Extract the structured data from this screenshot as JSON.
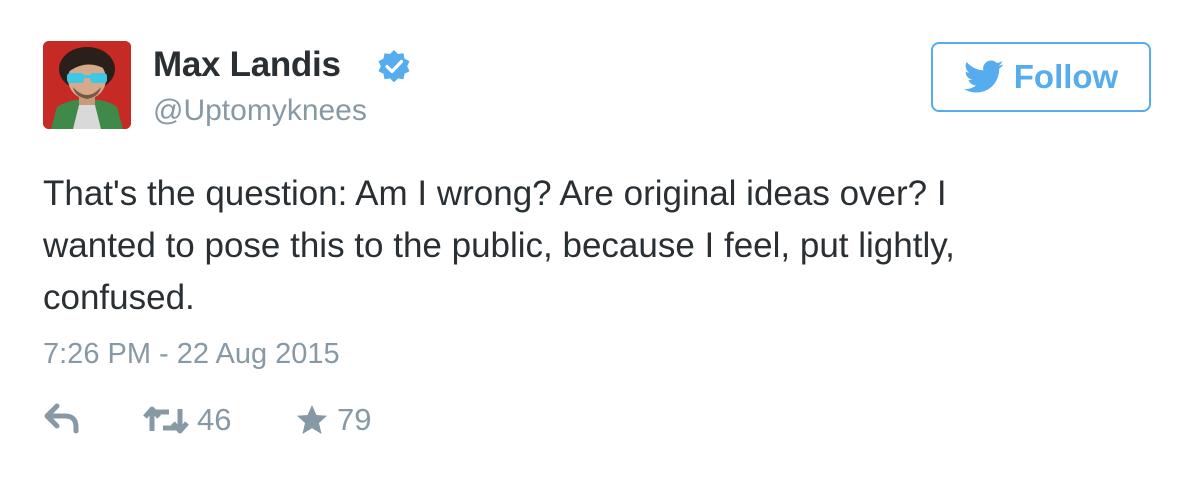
{
  "user": {
    "display_name": "Max Landis",
    "handle": "@Uptomyknees",
    "verified_icon": "verified-badge-icon"
  },
  "follow_button": {
    "label": "Follow",
    "icon": "twitter-bird-icon"
  },
  "tweet": {
    "text_lines": [
      "That's the question: Am I wrong? Are original ideas over? I",
      "wanted to pose this to the public, because I feel, put lightly,",
      "confused."
    ],
    "timestamp": "7:26 PM - 22 Aug 2015"
  },
  "actions": {
    "reply_icon": "reply-icon",
    "retweet_icon": "retweet-icon",
    "retweet_count": "46",
    "favorite_icon": "star-icon",
    "favorite_count": "79"
  },
  "colors": {
    "accent": "#55acee",
    "text": "#292f33",
    "muted": "#8899a6",
    "avatar_bg": "#c62a24"
  }
}
